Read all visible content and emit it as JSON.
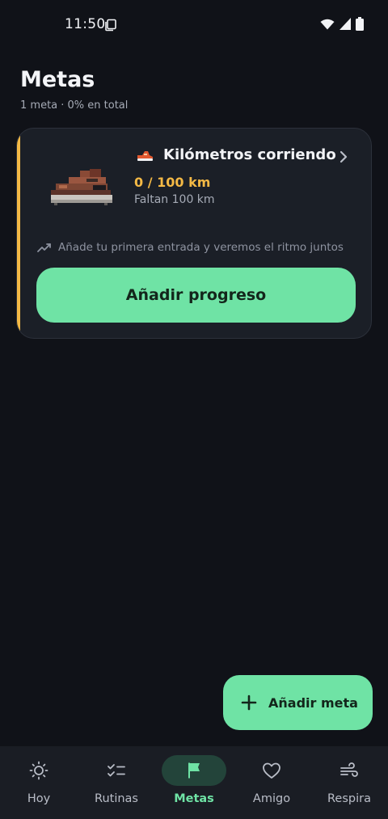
{
  "status_bar": {
    "time": "11:50",
    "icons": [
      "screenshot-icon",
      "wifi-icon",
      "signal-icon",
      "battery-icon"
    ]
  },
  "header": {
    "title": "Metas",
    "subtitle": "1 meta · 0% en total"
  },
  "goal": {
    "emoji_icon": "running-shoe-icon",
    "name": "Kilómetros corriendo",
    "progress_text": "0 / 100 km",
    "progress_fraction": 0,
    "remaining_text": "Faltan 100 km",
    "hint": "Añade tu primera entrada y veremos el ritmo juntos",
    "action_label": "Añadir progreso",
    "accent_color": "#f4b945"
  },
  "fab": {
    "label": "Añadir meta",
    "icon": "plus-icon"
  },
  "nav": {
    "items": [
      {
        "label": "Hoy",
        "icon": "sun-icon",
        "active": false
      },
      {
        "label": "Rutinas",
        "icon": "checklist-icon",
        "active": false
      },
      {
        "label": "Metas",
        "icon": "flag-icon",
        "active": true
      },
      {
        "label": "Amigo",
        "icon": "heart-icon",
        "active": false
      },
      {
        "label": "Respira",
        "icon": "wind-icon",
        "active": false
      }
    ]
  },
  "colors": {
    "background": "#101218",
    "card": "#1b1f27",
    "primary": "#6fe3a5",
    "accent": "#f4b945",
    "nav_background": "#1a1d24"
  }
}
